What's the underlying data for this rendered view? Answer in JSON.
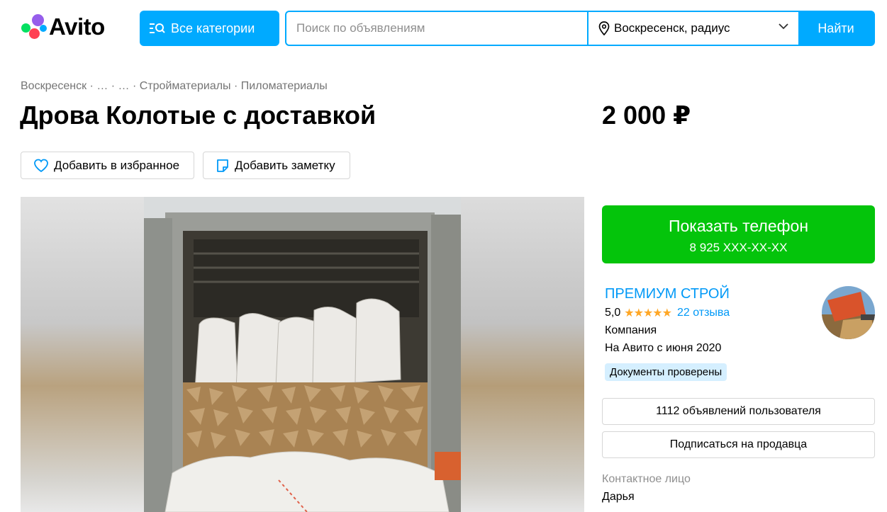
{
  "header": {
    "logo_text": "Avito",
    "categories_button": "Все категории",
    "search_placeholder": "Поиск по объявлениям",
    "location": "Воскресенск, радиус",
    "find_button": "Найти",
    "brand_color": "#00aaff"
  },
  "breadcrumb": [
    "Воскресенск",
    "…",
    "…",
    "Стройматериалы",
    "Пиломатериалы"
  ],
  "breadcrumb_separator": " · ",
  "listing": {
    "title": "Дрова Колотые с доставкой",
    "price": "2 000 ₽",
    "favorite_button": "Добавить в избранное",
    "note_button": "Добавить заметку"
  },
  "contact": {
    "show_phone_label": "Показать телефон",
    "phone_masked": "8 925 XXX-XX-XX",
    "phone_button_color": "#04c40b"
  },
  "seller": {
    "name": "ПРЕМИУМ СТРОЙ",
    "rating": "5,0",
    "stars": 5,
    "reviews": "22 отзыва",
    "type": "Компания",
    "since": "На Авито с июня 2020",
    "verified_badge": "Документы проверены",
    "listings_button": "1112 объявлений пользователя",
    "subscribe_button": "Подписаться на продавца",
    "contact_person_label": "Контактное лицо",
    "contact_person_name": "Дарья"
  },
  "icons": {
    "search": "search-icon",
    "location": "location-pin-icon",
    "chevron": "chevron-down-icon",
    "favorite": "heart-icon",
    "note": "note-icon"
  }
}
